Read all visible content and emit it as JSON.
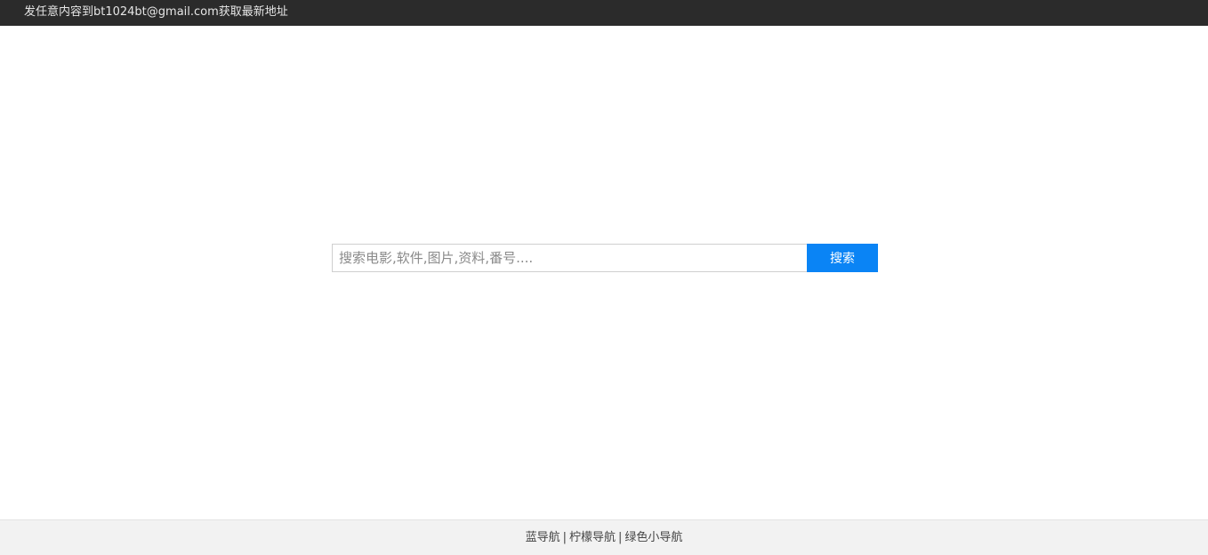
{
  "topbar": {
    "notice": "发任意内容到bt1024bt@gmail.com获取最新地址"
  },
  "search": {
    "placeholder": "搜索电影,软件,图片,资料,番号....",
    "value": "",
    "button_label": "搜索"
  },
  "footer": {
    "links": [
      {
        "label": "蓝导航"
      },
      {
        "label": "柠檬导航"
      },
      {
        "label": "绿色小导航"
      }
    ],
    "separator": "|"
  },
  "colors": {
    "topbar_bg": "#2b2b2b",
    "accent": "#0a84f5",
    "footer_bg": "#f2f2f2"
  }
}
